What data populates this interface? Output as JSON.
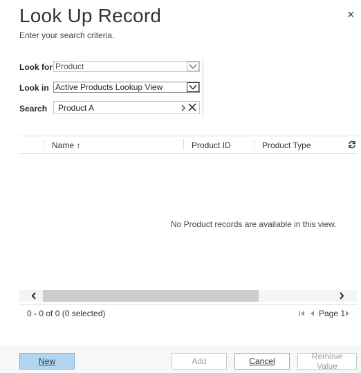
{
  "dialog": {
    "title": "Look Up Record",
    "subtitle": "Enter your search criteria.",
    "close_glyph": "×"
  },
  "form": {
    "look_for_label": "Look for",
    "look_for_value": "Product",
    "look_in_label": "Look in",
    "look_in_value": "Active Products Lookup View",
    "search_label": "Search",
    "search_value": "Product A"
  },
  "grid": {
    "columns": [
      "Name ↑",
      "Product ID",
      "Product Type"
    ],
    "empty_message": "No Product records are available in this view.",
    "record_count": "0 - 0 of 0 (0 selected)",
    "page_label": "Page 1"
  },
  "buttons": {
    "new": "New",
    "add": "Add",
    "cancel": "Cancel",
    "remove_value": "Remove Value"
  },
  "colors": {
    "new_button_bg": "#b1d6f0",
    "new_button_border": "#7fb2d8"
  },
  "icons": [
    "close-icon",
    "dropdown-arrow-icon",
    "search-arrow-icon",
    "clear-icon",
    "refresh-icon",
    "scroll-left-icon",
    "scroll-right-icon",
    "first-page-icon",
    "prev-page-icon",
    "next-page-icon"
  ]
}
